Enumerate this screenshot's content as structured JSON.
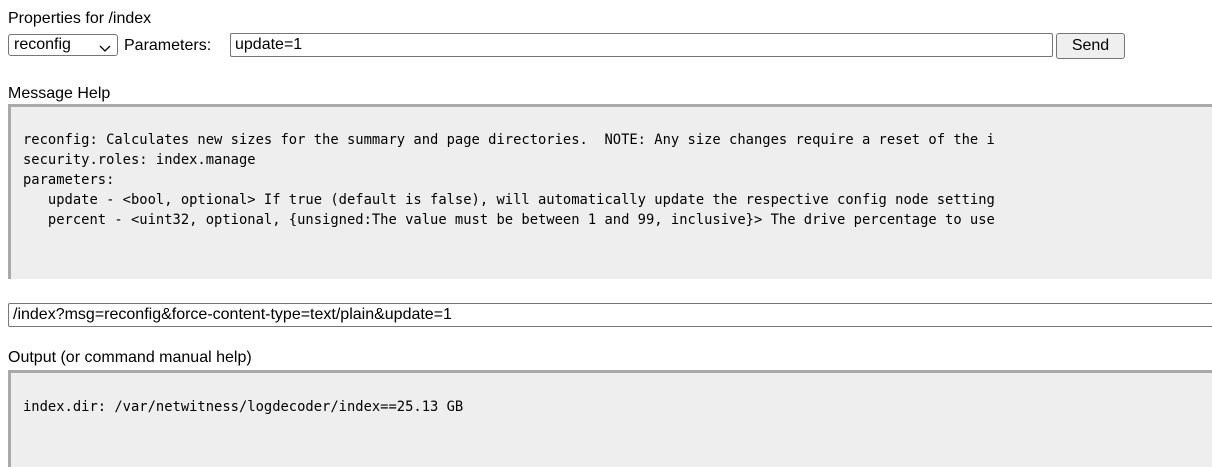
{
  "header": {
    "title": "Properties for /index"
  },
  "controls": {
    "message_select": {
      "selected": "reconfig",
      "icon": "chevron-down-icon"
    },
    "parameters_label": "Parameters:",
    "parameters_value": "update=1",
    "send_label": "Send"
  },
  "help": {
    "label": "Message Help",
    "text": "reconfig: Calculates new sizes for the summary and page directories.  NOTE: Any size changes require a reset of the i\nsecurity.roles: index.manage\nparameters:\n   update - <bool, optional> If true (default is false), will automatically update the respective config node setting\n   percent - <uint32, optional, {unsigned:The value must be between 1 and 99, inclusive}> The drive percentage to use"
  },
  "url": {
    "value": "/index?msg=reconfig&force-content-type=text/plain&update=1"
  },
  "output": {
    "label": "Output (or command manual help)",
    "text": "index.dir: /var/netwitness/logdecoder/index==25.13 GB"
  }
}
